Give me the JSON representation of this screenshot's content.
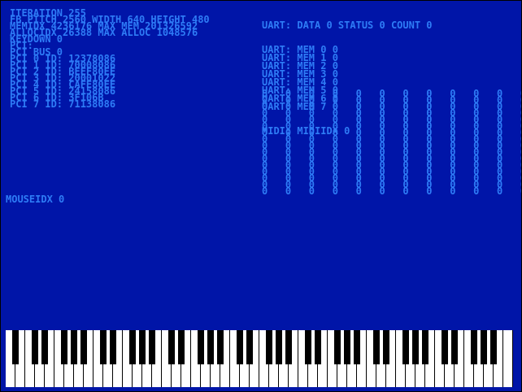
{
  "left_log": [
    "ITERATION 255",
    "FB PITCH 2560 WIDTH 640 HEIGHT 480",
    "MEMIDX 4236176 MAX MEM 201326592",
    "ALLOCIDX 26388 MAX ALLOC 1048576",
    "KEYDOWN 0",
    "PCI:",
    "PCI BUS 0",
    "PCI 0 ID: 12378086",
    "PCI 1 ID: 70008086",
    "PCI 2 ID: BEEF80EE",
    "PCI 3 ID: 20001022",
    "PCI 4 ID: CAFE80EE",
    "PCI 5 ID: 24158086",
    "PCI 6 ID: 3F106B",
    "PCI 7 ID: 71138086"
  ],
  "uart_status": "UART: DATA 0 STATUS 0 COUNT 0",
  "uart_mem": [
    "UART: MEM 0 0",
    "UART: MEM 1 0",
    "UART: MEM 2 0",
    "UART: MEM 3 0",
    "UART: MEM 4 0",
    "UART: MEM 5 0",
    "UART: MEM 6 0",
    "UART: MEM 7 0"
  ],
  "midi_line": "MIDI: MIDIIDX 0",
  "midi_grid": {
    "rows": 16,
    "cols": 16,
    "value": "0"
  },
  "mouse_line": "MOUSEIDX 0",
  "colors": {
    "background": "#0015a8",
    "text": "#2e7cf6",
    "white_key": "#ffffff",
    "black_key": "#000000"
  },
  "piano": {
    "white_keys": 52
  }
}
